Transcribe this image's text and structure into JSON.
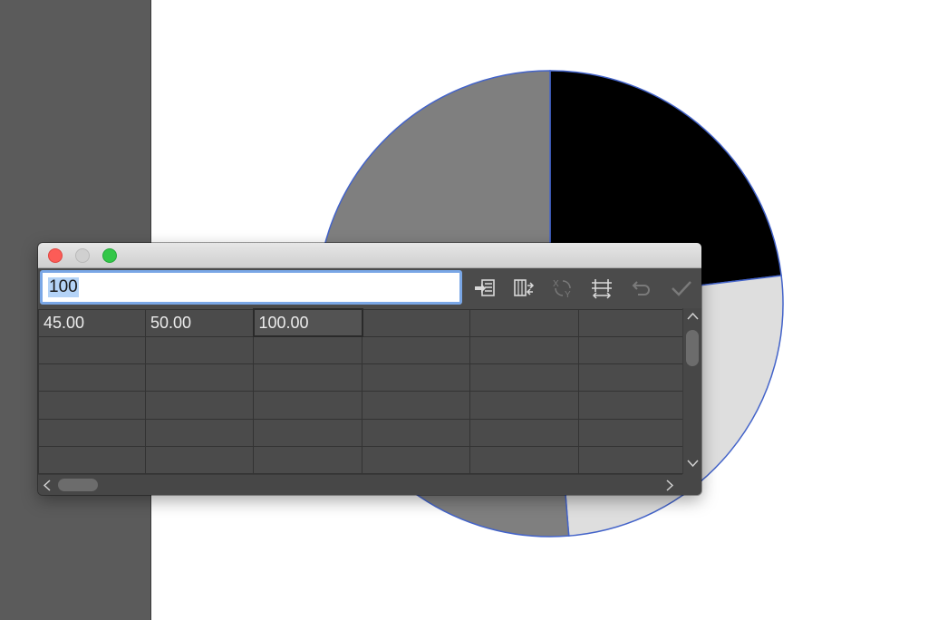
{
  "colors": {
    "workspace": "#5b5b5b",
    "artboard": "#ffffff",
    "panel": "#4b4b4b",
    "selection_stroke": "#4363c9"
  },
  "chart_data": {
    "type": "pie",
    "values": [
      45.0,
      50.0,
      100.0
    ],
    "slice_colors": [
      "#000000",
      "#dedede",
      "#7f7f7f"
    ]
  },
  "graph_data_window": {
    "title_buttons": [
      "close",
      "minimize",
      "zoom"
    ],
    "entry_value": "100",
    "toolbar_icons": [
      "import-data-icon",
      "transpose-icon",
      "switch-xy-icon",
      "cell-style-icon",
      "revert-icon",
      "apply-icon"
    ],
    "grid": {
      "rows": [
        [
          "45.00",
          "50.00",
          "100.00",
          "",
          "",
          ""
        ],
        [
          "",
          "",
          "",
          "",
          "",
          ""
        ],
        [
          "",
          "",
          "",
          "",
          "",
          ""
        ],
        [
          "",
          "",
          "",
          "",
          "",
          ""
        ],
        [
          "",
          "",
          "",
          "",
          "",
          ""
        ],
        [
          "",
          "",
          "",
          "",
          "",
          ""
        ]
      ]
    }
  }
}
